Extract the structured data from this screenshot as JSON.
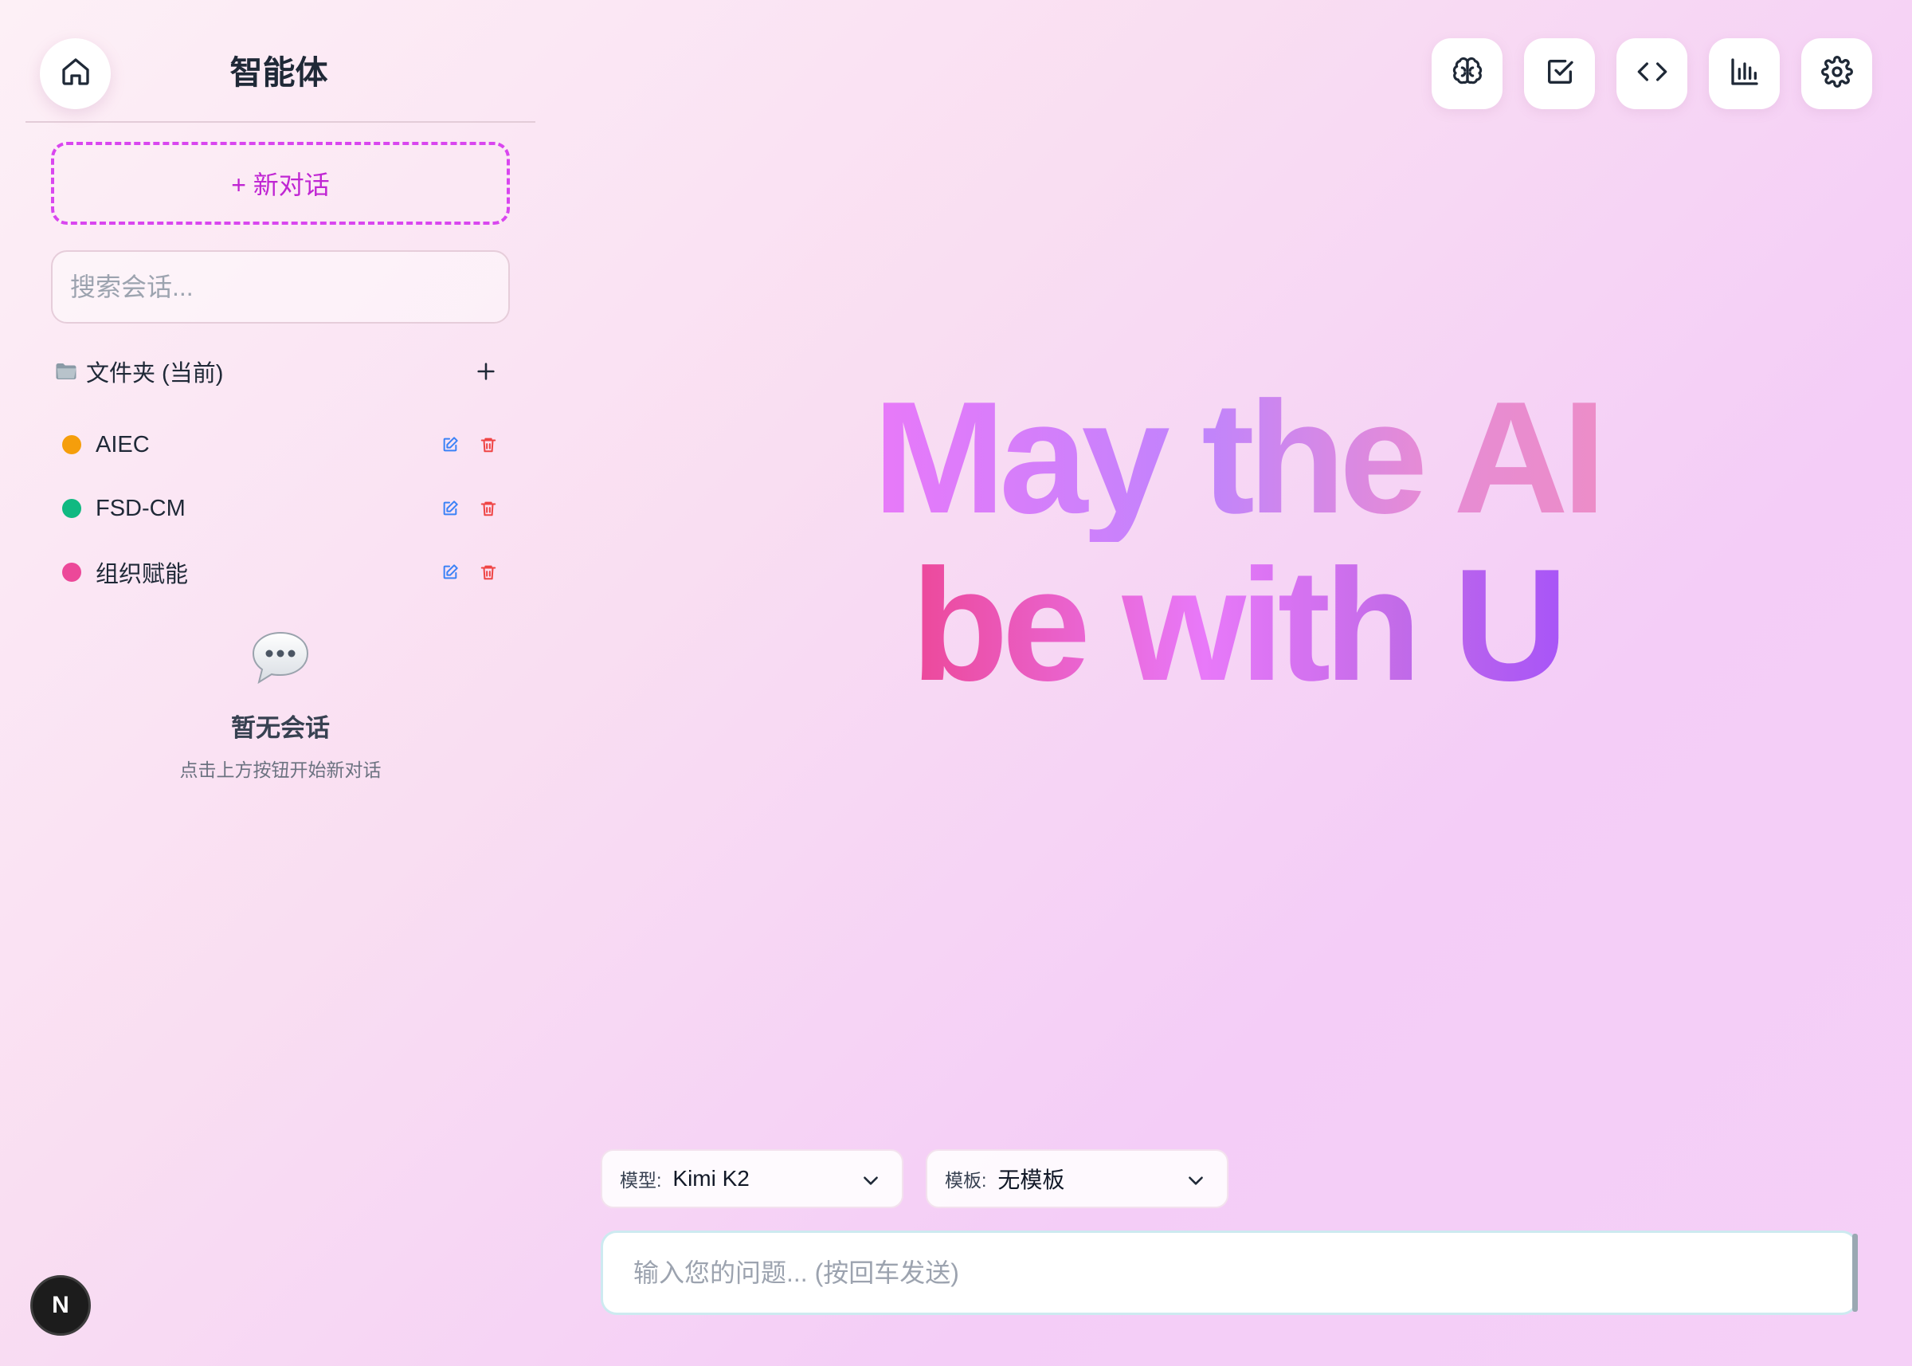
{
  "sidebar": {
    "title": "智能体",
    "new_chat_label": "+ 新对话",
    "search_placeholder": "搜索会话...",
    "folder_header": "文件夹 (当前)",
    "folders": [
      {
        "name": "AIEC",
        "color": "#f59e0b"
      },
      {
        "name": "FSD-CM",
        "color": "#10b981"
      },
      {
        "name": "组织赋能",
        "color": "#ec4899"
      }
    ],
    "empty_title": "暂无会话",
    "empty_hint": "点击上方按钮开始新对话"
  },
  "toolbar": {
    "icons": [
      "brain-icon",
      "checkbox-icon",
      "code-icon",
      "bar-chart-icon",
      "settings-icon"
    ]
  },
  "hero": {
    "line1": "May the AI",
    "line2": "be with U"
  },
  "selectors": {
    "model_label": "模型:",
    "model_value": "Kimi K2",
    "template_label": "模板:",
    "template_value": "无模板"
  },
  "chat": {
    "placeholder": "输入您的问题... (按回车发送)"
  },
  "badge": {
    "letter": "N"
  },
  "colors": {
    "accent": "#d946ef",
    "edit": "#3b82f6",
    "delete": "#ef4444"
  }
}
